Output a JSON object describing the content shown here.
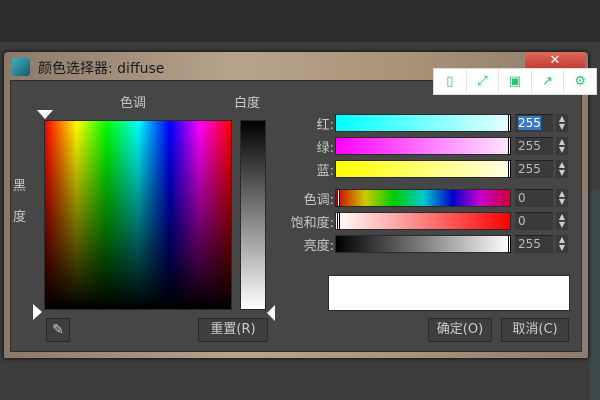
{
  "dialog": {
    "title": "颜色选择器: diffuse",
    "close": "✕"
  },
  "toolbar": {
    "icons": [
      "phone-icon",
      "fullscreen-icon",
      "save-icon",
      "share-icon",
      "settings-icon"
    ]
  },
  "labels": {
    "hue": "色调",
    "whiteness": "白度",
    "blackness_1": "黑",
    "blackness_2": "度"
  },
  "sliders": [
    {
      "label": "红:",
      "value": "255",
      "selected": true
    },
    {
      "label": "绿:",
      "value": "255"
    },
    {
      "label": "蓝:",
      "value": "255"
    },
    {
      "label": "色调:",
      "value": "0"
    },
    {
      "label": "饱和度:",
      "value": "0"
    },
    {
      "label": "亮度:",
      "value": "255"
    }
  ],
  "buttons": {
    "reset": "重置(R)",
    "ok": "确定(O)",
    "cancel": "取消(C)"
  },
  "colors": {
    "current": "#ffffff",
    "accent": "#2cc36b"
  }
}
